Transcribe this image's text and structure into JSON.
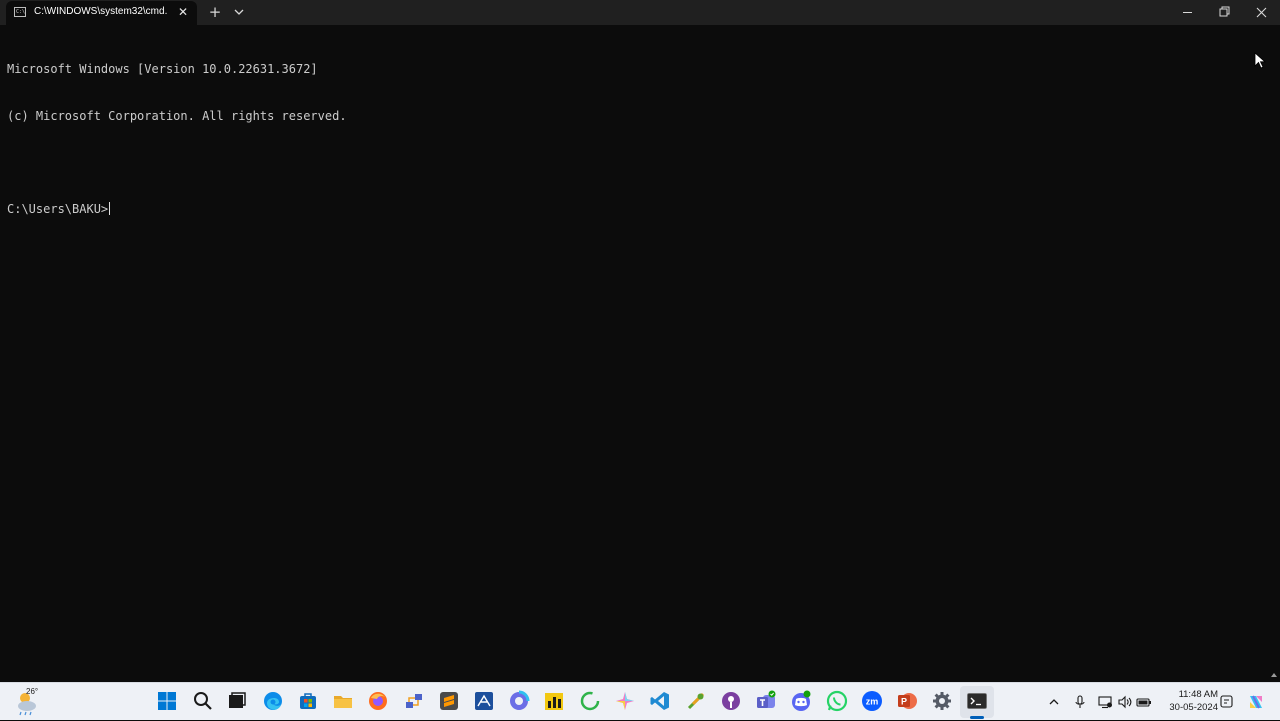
{
  "window": {
    "tab_title": "C:\\WINDOWS\\system32\\cmd.",
    "tab_icon_text": "C:\\",
    "new_tab_label": "+",
    "close_tab_label": "✕"
  },
  "console": {
    "lines": [
      "Microsoft Windows [Version 10.0.22631.3672]",
      "(c) Microsoft Corporation. All rights reserved.",
      "",
      "C:\\Users\\BAKU>"
    ]
  },
  "taskbar": {
    "weather_temp": "26°",
    "pinned": [
      {
        "name": "start-icon",
        "color": "#0078d4"
      },
      {
        "name": "search-icon",
        "color": "#1a1a1a"
      },
      {
        "name": "task-view-icon",
        "color": "#1a1a1a"
      },
      {
        "name": "edge-icon",
        "color": "#0c8ce9"
      },
      {
        "name": "store-icon",
        "color": "#0f6cbd"
      },
      {
        "name": "file-explorer-icon",
        "color": "#f7c244"
      },
      {
        "name": "firefox-icon",
        "color": "#ff6d1f"
      },
      {
        "name": "network-app-icon",
        "color": "#4b62c9"
      },
      {
        "name": "sublime-text-icon",
        "color": "#ff9800"
      },
      {
        "name": "cisco-packet-tracer-icon",
        "color": "#1c4f9c"
      },
      {
        "name": "copilot-icon",
        "color": "#6b6ee6"
      },
      {
        "name": "power-bi-icon",
        "color": "#f2c811"
      },
      {
        "name": "refresh-app-icon",
        "color": "#2fb34a"
      },
      {
        "name": "gemini-app-icon",
        "color": "#f07cc7"
      },
      {
        "name": "vscode-icon",
        "color": "#1f8ad2"
      },
      {
        "name": "tools-app-icon",
        "color": "#5aa22e"
      },
      {
        "name": "podcast-app-icon",
        "color": "#7b3fa0"
      },
      {
        "name": "teams-icon",
        "color": "#5b5fc7"
      },
      {
        "name": "discord-icon",
        "color": "#5865f2"
      },
      {
        "name": "whatsapp-icon",
        "color": "#25d366"
      },
      {
        "name": "zoom-icon",
        "color": "#0b5cff"
      },
      {
        "name": "powerpoint-icon",
        "color": "#c43e1c"
      },
      {
        "name": "settings-icon",
        "color": "#555b66"
      },
      {
        "name": "terminal-icon",
        "color": "#2b2b2b"
      }
    ],
    "zoom_label": "zm",
    "clock_time": "11:48 AM",
    "clock_date": "30-05-2024",
    "tray": [
      {
        "name": "chevron-up-icon"
      },
      {
        "name": "microphone-icon"
      },
      {
        "name": "network-icon"
      },
      {
        "name": "volume-icon"
      },
      {
        "name": "battery-icon"
      },
      {
        "name": "notification-icon"
      },
      {
        "name": "copilot-tray-icon"
      }
    ]
  }
}
